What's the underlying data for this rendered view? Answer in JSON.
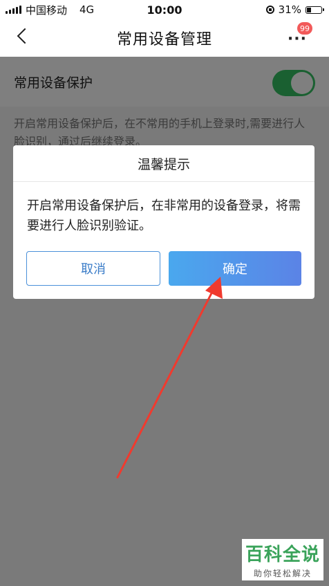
{
  "status_bar": {
    "carrier": "中国移动",
    "network": "4G",
    "time": "10:00",
    "battery": "31%",
    "battery_level": 0.31
  },
  "nav": {
    "title": "常用设备管理",
    "more_label": "···",
    "badge_count": "99"
  },
  "settings": {
    "device_protection_label": "常用设备保护",
    "device_protection_enabled": true,
    "description": "开启常用设备保护后，在不常用的手机上登录时,需要进行人脸识别，通过后继续登录。"
  },
  "dialog": {
    "title": "温馨提示",
    "message": "开启常用设备保护后，在非常用的设备登录，将需要进行人脸识别验证。",
    "cancel_label": "取消",
    "confirm_label": "确定"
  },
  "watermark": {
    "main": "百科全说",
    "sub": "助你轻松解决"
  },
  "colors": {
    "toggle_on": "#35c062",
    "primary": "#4a90d9",
    "annotation": "#f03a2e",
    "badge": "#f25a5a"
  },
  "icons": [
    "back-chevron-icon",
    "more-dots-icon",
    "rotation-lock-icon",
    "battery-icon",
    "signal-icon"
  ]
}
